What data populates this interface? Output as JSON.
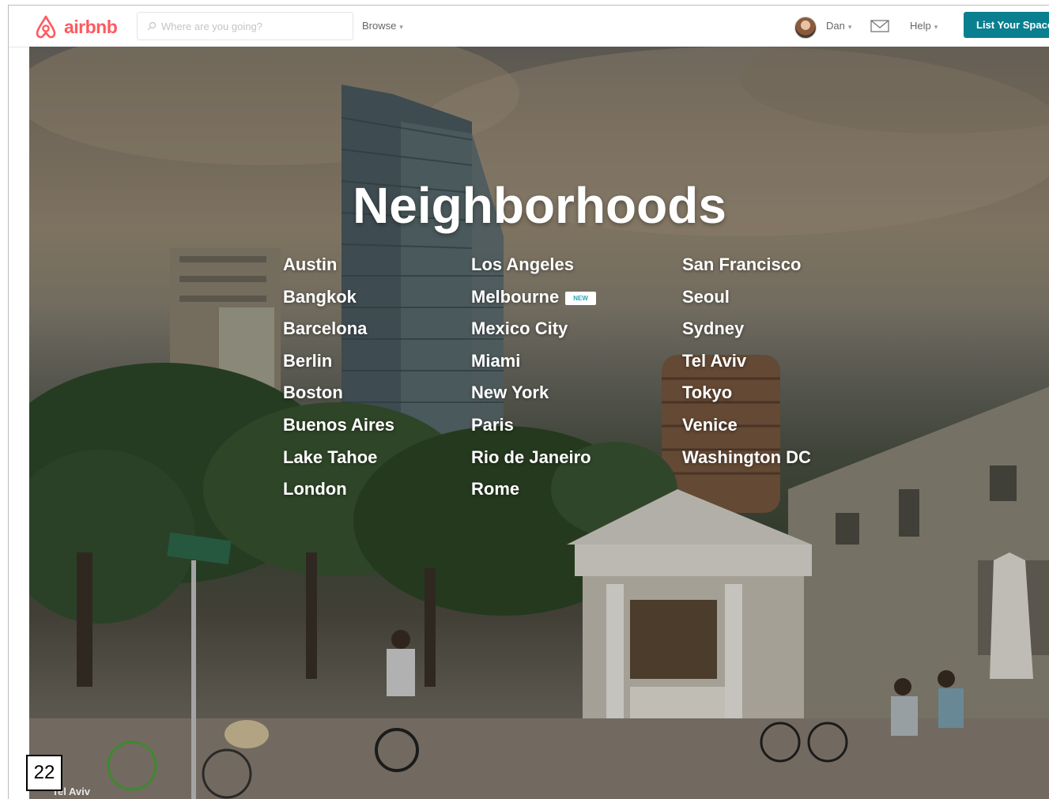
{
  "header": {
    "logo_text": "airbnb",
    "search_placeholder": "Where are you going?",
    "browse_label": "Browse",
    "user_name": "Dan",
    "help_label": "Help",
    "list_space_label": "List Your Space"
  },
  "hero": {
    "title": "Neighborhoods",
    "columns": [
      [
        "Austin",
        "Bangkok",
        "Barcelona",
        "Berlin",
        "Boston",
        "Buenos Aires",
        "Lake Tahoe",
        "London"
      ],
      [
        "Los Angeles",
        "Melbourne",
        "Mexico City",
        "Miami",
        "New York",
        "Paris",
        "Rio de Janeiro",
        "Rome"
      ],
      [
        "San Francisco",
        "Seoul",
        "Sydney",
        "Tel Aviv",
        "Tokyo",
        "Venice",
        "Washington DC"
      ]
    ],
    "new_badge": "NEW",
    "photo_caption": "Tel Aviv"
  },
  "page_number": "22",
  "colors": {
    "brand": "#ff5a5f",
    "button": "#0a7f8f",
    "badge_text": "#28a8b8"
  }
}
